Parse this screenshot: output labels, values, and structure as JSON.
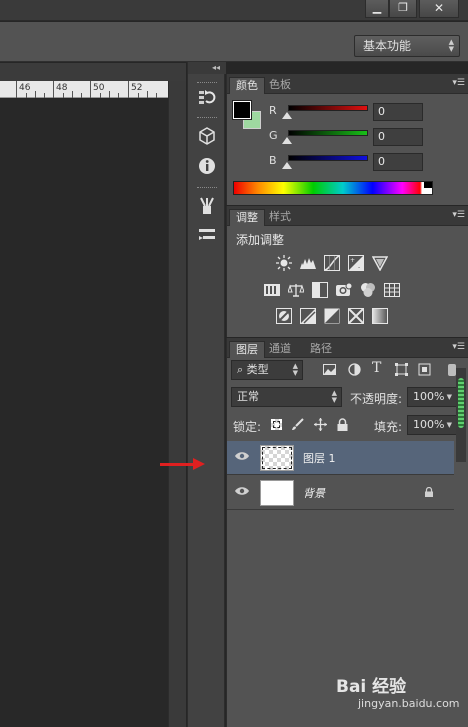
{
  "window": {
    "minimize": "▁",
    "maximize": "❐",
    "close": "✕"
  },
  "options_bar": {
    "workspace": "基本功能"
  },
  "ruler": {
    "labels": [
      "46",
      "48",
      "50",
      "52"
    ]
  },
  "dock": {
    "collapse": "◂◂",
    "icons": [
      "history-icon",
      "3d-icon",
      "info-icon",
      "brush-icon",
      "tool-presets-icon"
    ]
  },
  "color_panel": {
    "tabs": [
      "颜色",
      "色板"
    ],
    "foreground": "#000000",
    "background": "#9ed8a0",
    "channels": [
      {
        "name": "R",
        "value": "0",
        "color": "#e01010"
      },
      {
        "name": "G",
        "value": "0",
        "color": "#18c018"
      },
      {
        "name": "B",
        "value": "0",
        "color": "#1010e0"
      }
    ]
  },
  "adjustments_panel": {
    "tabs": [
      "调整",
      "样式"
    ],
    "title": "添加调整",
    "icons": [
      "brightness-contrast-icon",
      "levels-icon",
      "curves-icon",
      "exposure-icon",
      "vibrance-icon",
      "hue-saturation-icon",
      "color-balance-icon",
      "black-white-icon",
      "photo-filter-icon",
      "channel-mixer-icon",
      "color-lookup-icon",
      "invert-icon",
      "posterize-icon",
      "threshold-icon",
      "selective-color-icon",
      "gradient-map-icon"
    ]
  },
  "layers_panel": {
    "tabs": [
      "图层",
      "通道",
      "路径"
    ],
    "filter_kind": "类型",
    "blend_mode": "正常",
    "opacity_label": "不透明度:",
    "opacity": "100%",
    "lock_label": "锁定:",
    "fill_label": "填充:",
    "fill": "100%",
    "layers": [
      {
        "name": "图层 1",
        "selected": true,
        "transparent": true
      },
      {
        "name": "背景",
        "selected": false,
        "transparent": false,
        "locked": true
      }
    ]
  },
  "annotation": {
    "arrow_color": "#e02020"
  },
  "watermark": {
    "brand": "Bai 经验",
    "url": "jingyan.baidu.com"
  }
}
